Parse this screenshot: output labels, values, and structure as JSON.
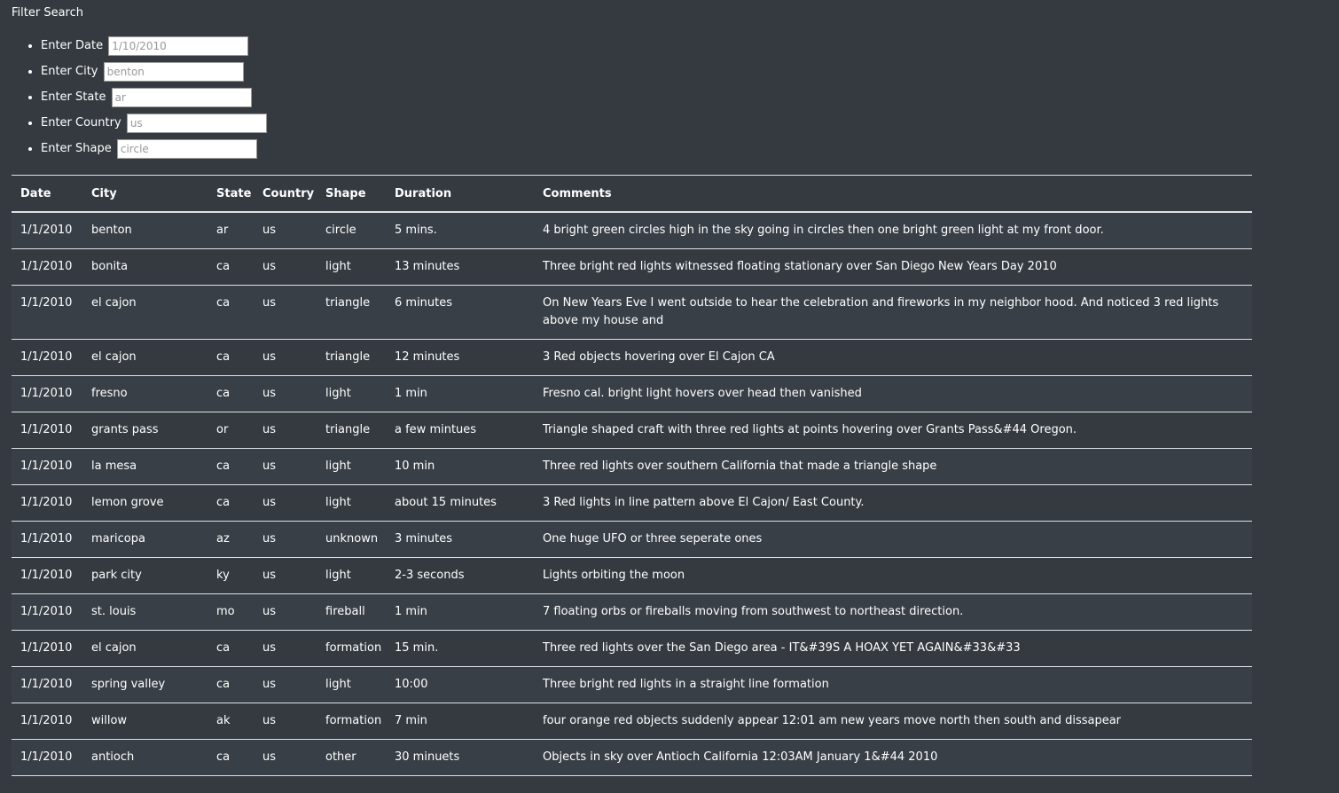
{
  "filter": {
    "title": "Filter Search",
    "fields": [
      {
        "label": "Enter Date",
        "placeholder": "1/10/2010"
      },
      {
        "label": "Enter City",
        "placeholder": "benton"
      },
      {
        "label": "Enter State",
        "placeholder": "ar"
      },
      {
        "label": "Enter Country",
        "placeholder": "us"
      },
      {
        "label": "Enter Shape",
        "placeholder": "circle"
      }
    ]
  },
  "table": {
    "headers": [
      "Date",
      "City",
      "State",
      "Country",
      "Shape",
      "Duration",
      "Comments"
    ],
    "rows": [
      [
        "1/1/2010",
        "benton",
        "ar",
        "us",
        "circle",
        "5 mins.",
        "4 bright green circles high in the sky going in circles then one bright green light at my front door."
      ],
      [
        "1/1/2010",
        "bonita",
        "ca",
        "us",
        "light",
        "13 minutes",
        "Three bright red lights witnessed floating stationary over San Diego New Years Day 2010"
      ],
      [
        "1/1/2010",
        "el cajon",
        "ca",
        "us",
        "triangle",
        "6 minutes",
        "On New Years Eve I went outside to hear the celebration and fireworks in my neighbor hood. And noticed 3 red lights above my house and"
      ],
      [
        "1/1/2010",
        "el cajon",
        "ca",
        "us",
        "triangle",
        "12 minutes",
        "3 Red objects hovering over El Cajon CA"
      ],
      [
        "1/1/2010",
        "fresno",
        "ca",
        "us",
        "light",
        "1 min",
        "Fresno cal. bright light hovers over head then vanished"
      ],
      [
        "1/1/2010",
        "grants pass",
        "or",
        "us",
        "triangle",
        "a few mintues",
        "Triangle shaped craft with three red lights at points hovering over Grants Pass&#44 Oregon."
      ],
      [
        "1/1/2010",
        "la mesa",
        "ca",
        "us",
        "light",
        "10 min",
        "Three red lights over southern California that made a triangle shape"
      ],
      [
        "1/1/2010",
        "lemon grove",
        "ca",
        "us",
        "light",
        "about 15 minutes",
        "3 Red lights in line pattern above El Cajon/ East County."
      ],
      [
        "1/1/2010",
        "maricopa",
        "az",
        "us",
        "unknown",
        "3 minutes",
        "One huge UFO or three seperate ones"
      ],
      [
        "1/1/2010",
        "park city",
        "ky",
        "us",
        "light",
        "2-3 seconds",
        "Lights orbiting the moon"
      ],
      [
        "1/1/2010",
        "st. louis",
        "mo",
        "us",
        "fireball",
        "1 min",
        "7 floating orbs or fireballs moving from southwest to northeast direction."
      ],
      [
        "1/1/2010",
        "el cajon",
        "ca",
        "us",
        "formation",
        "15 min.",
        "Three red lights over the San Diego area - IT&#39S A HOAX YET AGAIN&#33&#33"
      ],
      [
        "1/1/2010",
        "spring valley",
        "ca",
        "us",
        "light",
        "10:00",
        "Three bright red lights in a straight line formation"
      ],
      [
        "1/1/2010",
        "willow",
        "ak",
        "us",
        "formation",
        "7 min",
        "four orange red objects suddenly appear 12:01 am new years move north then south and dissapear"
      ],
      [
        "1/1/2010",
        "antioch",
        "ca",
        "us",
        "other",
        "30 minuets",
        "Objects in sky over Antioch California 12:03AM January 1&#44 2010"
      ]
    ]
  }
}
